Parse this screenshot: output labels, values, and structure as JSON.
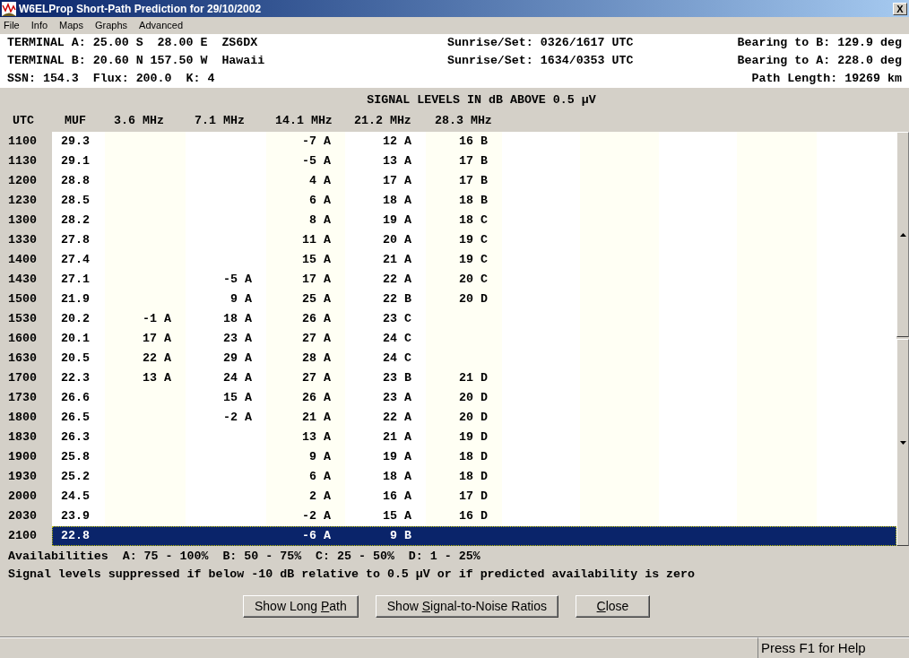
{
  "window": {
    "title": "W6ELProp Short-Path Prediction for 29/10/2002",
    "close": "X"
  },
  "menu": [
    "File",
    "Info",
    "Maps",
    "Graphs",
    "Advanced"
  ],
  "header": [
    {
      "left": "TERMINAL A: 25.00 S  28.00 E  ZS6DX",
      "sun": "Sunrise/Set: 0326/1617 UTC",
      "right": "Bearing to B: 129.9 deg"
    },
    {
      "left": "TERMINAL B: 20.60 N 157.50 W  Hawaii",
      "sun": "Sunrise/Set: 1634/0353 UTC",
      "right": "Bearing to A: 228.0 deg"
    },
    {
      "left": "SSN: 154.3  Flux: 200.0  K: 4",
      "right": "Path Length: 19269 km"
    }
  ],
  "table": {
    "title": "SIGNAL LEVELS IN dB ABOVE 0.5 µV",
    "columns": [
      "UTC",
      "MUF",
      "3.6 MHz",
      "7.1 MHz",
      "14.1 MHz",
      "21.2 MHz",
      "28.3 MHz"
    ],
    "rows": [
      {
        "cells": [
          "1100",
          "29.3",
          "",
          "",
          "-7 A",
          "12 A",
          "16 B"
        ],
        "selected": false
      },
      {
        "cells": [
          "1130",
          "29.1",
          "",
          "",
          "-5 A",
          "13 A",
          "17 B"
        ],
        "selected": false
      },
      {
        "cells": [
          "1200",
          "28.8",
          "",
          "",
          "4 A",
          "17 A",
          "17 B"
        ],
        "selected": false
      },
      {
        "cells": [
          "1230",
          "28.5",
          "",
          "",
          "6 A",
          "18 A",
          "18 B"
        ],
        "selected": false
      },
      {
        "cells": [
          "1300",
          "28.2",
          "",
          "",
          "8 A",
          "19 A",
          "18 C"
        ],
        "selected": false
      },
      {
        "cells": [
          "1330",
          "27.8",
          "",
          "",
          "11 A",
          "20 A",
          "19 C"
        ],
        "selected": false
      },
      {
        "cells": [
          "1400",
          "27.4",
          "",
          "",
          "15 A",
          "21 A",
          "19 C"
        ],
        "selected": false
      },
      {
        "cells": [
          "1430",
          "27.1",
          "",
          "-5 A",
          "17 A",
          "22 A",
          "20 C"
        ],
        "selected": false
      },
      {
        "cells": [
          "1500",
          "21.9",
          "",
          "9 A",
          "25 A",
          "22 B",
          "20 D"
        ],
        "selected": false
      },
      {
        "cells": [
          "1530",
          "20.2",
          "-1 A",
          "18 A",
          "26 A",
          "23 C",
          ""
        ],
        "selected": false
      },
      {
        "cells": [
          "1600",
          "20.1",
          "17 A",
          "23 A",
          "27 A",
          "24 C",
          ""
        ],
        "selected": false
      },
      {
        "cells": [
          "1630",
          "20.5",
          "22 A",
          "29 A",
          "28 A",
          "24 C",
          ""
        ],
        "selected": false
      },
      {
        "cells": [
          "1700",
          "22.3",
          "13 A",
          "24 A",
          "27 A",
          "23 B",
          "21 D"
        ],
        "selected": false
      },
      {
        "cells": [
          "1730",
          "26.6",
          "",
          "15 A",
          "26 A",
          "23 A",
          "20 D"
        ],
        "selected": false
      },
      {
        "cells": [
          "1800",
          "26.5",
          "",
          "-2 A",
          "21 A",
          "22 A",
          "20 D"
        ],
        "selected": false
      },
      {
        "cells": [
          "1830",
          "26.3",
          "",
          "",
          "13 A",
          "21 A",
          "19 D"
        ],
        "selected": false
      },
      {
        "cells": [
          "1900",
          "25.8",
          "",
          "",
          "9 A",
          "19 A",
          "18 D"
        ],
        "selected": false
      },
      {
        "cells": [
          "1930",
          "25.2",
          "",
          "",
          "6 A",
          "18 A",
          "18 D"
        ],
        "selected": false
      },
      {
        "cells": [
          "2000",
          "24.5",
          "",
          "",
          "2 A",
          "16 A",
          "17 D"
        ],
        "selected": false
      },
      {
        "cells": [
          "2030",
          "23.9",
          "",
          "",
          "-2 A",
          "15 A",
          "16 D"
        ],
        "selected": false
      },
      {
        "cells": [
          "2100",
          "22.8",
          "",
          "",
          "-6 A",
          "9 B",
          ""
        ],
        "selected": true
      }
    ]
  },
  "notes": [
    "Availabilities  A: 75 - 100%  B: 50 - 75%  C: 25 - 50%  D: 1 - 25%",
    "Signal levels suppressed if below -10 dB relative to 0.5 µV or if predicted availability is zero"
  ],
  "buttons": [
    {
      "before": "Show Long ",
      "mnemonic": "P",
      "after": "ath"
    },
    {
      "before": "Show ",
      "mnemonic": "S",
      "after": "ignal-to-Noise Ratios"
    },
    {
      "mnemonic": "C",
      "after": "lose"
    }
  ],
  "status_bar": {
    "help": "Press F1 for Help"
  }
}
